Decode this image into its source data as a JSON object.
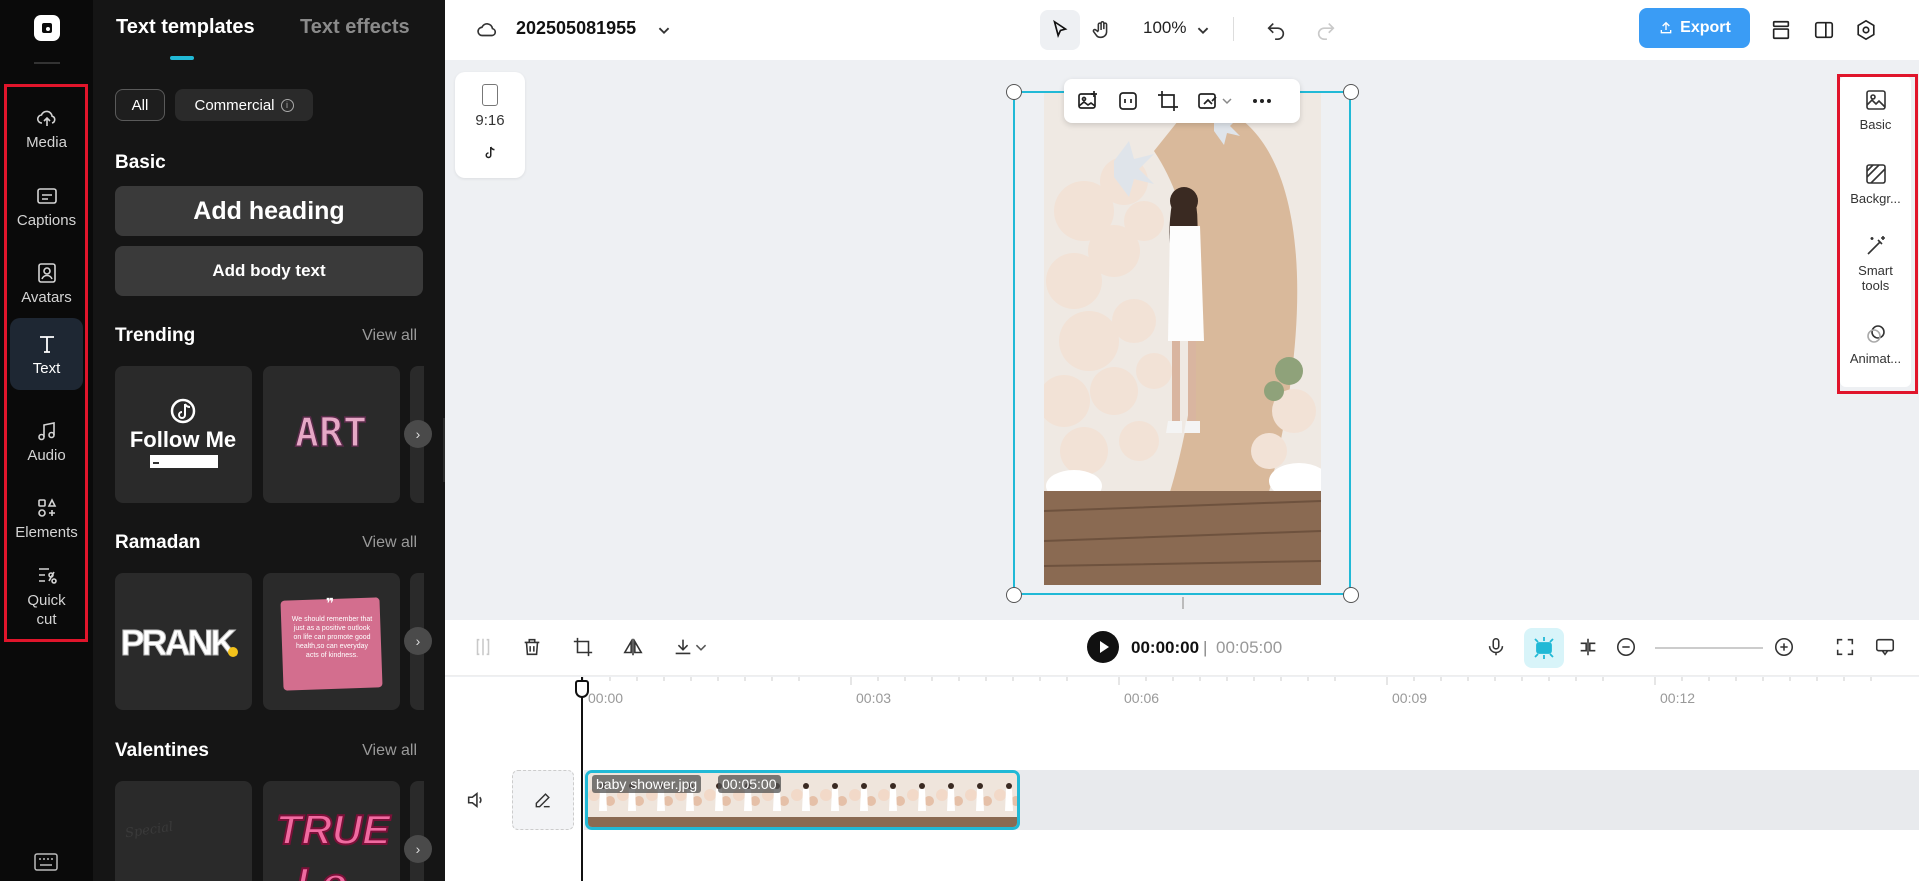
{
  "rail": {
    "items": [
      {
        "label": "Media",
        "icon": "cloud-upload-icon"
      },
      {
        "label": "Captions",
        "icon": "captions-icon"
      },
      {
        "label": "Avatars",
        "icon": "avatar-icon"
      },
      {
        "label": "Text",
        "icon": "text-icon"
      },
      {
        "label": "Audio",
        "icon": "music-note-icon"
      },
      {
        "label": "Elements",
        "icon": "elements-icon"
      },
      {
        "label": "Quick\ncut",
        "icon": "quick-cut-icon"
      }
    ],
    "active": "Text"
  },
  "panel": {
    "tab_templates": "Text templates",
    "tab_effects": "Text effects",
    "chip_all": "All",
    "chip_commercial": "Commercial",
    "basic_title": "Basic",
    "add_heading": "Add heading",
    "add_body": "Add body text",
    "trending_title": "Trending",
    "ramadan_title": "Ramadan",
    "valentines_title": "Valentines",
    "view_all": "View all",
    "cards": {
      "follow_me": "Follow Me",
      "art": "ART",
      "prank": "PRANK",
      "quote": "We should remember that just as a positive outlook on life can promote good health,so can everyday acts of kindness.",
      "true_love": "TRUE",
      "love_partial": "Lo",
      "special": "Special"
    }
  },
  "topbar": {
    "project_name": "202505081955",
    "zoom": "100%",
    "export": "Export"
  },
  "canvas": {
    "ratio": "9:16"
  },
  "right_panel": {
    "items": [
      {
        "label": "Basic",
        "icon": "image-icon"
      },
      {
        "label": "Backgr...",
        "icon": "background-icon"
      },
      {
        "label": "Smart\ntools",
        "icon": "magic-wand-icon"
      },
      {
        "label": "Animat...",
        "icon": "animation-icon"
      }
    ]
  },
  "timeline": {
    "current_time": "00:00:00",
    "divider": "|",
    "total_time": "00:05:00",
    "ruler": [
      "00:00",
      "00:03",
      "00:06",
      "00:09",
      "00:12"
    ],
    "clip_name": "baby shower.jpg",
    "clip_duration": "00:05:00"
  }
}
